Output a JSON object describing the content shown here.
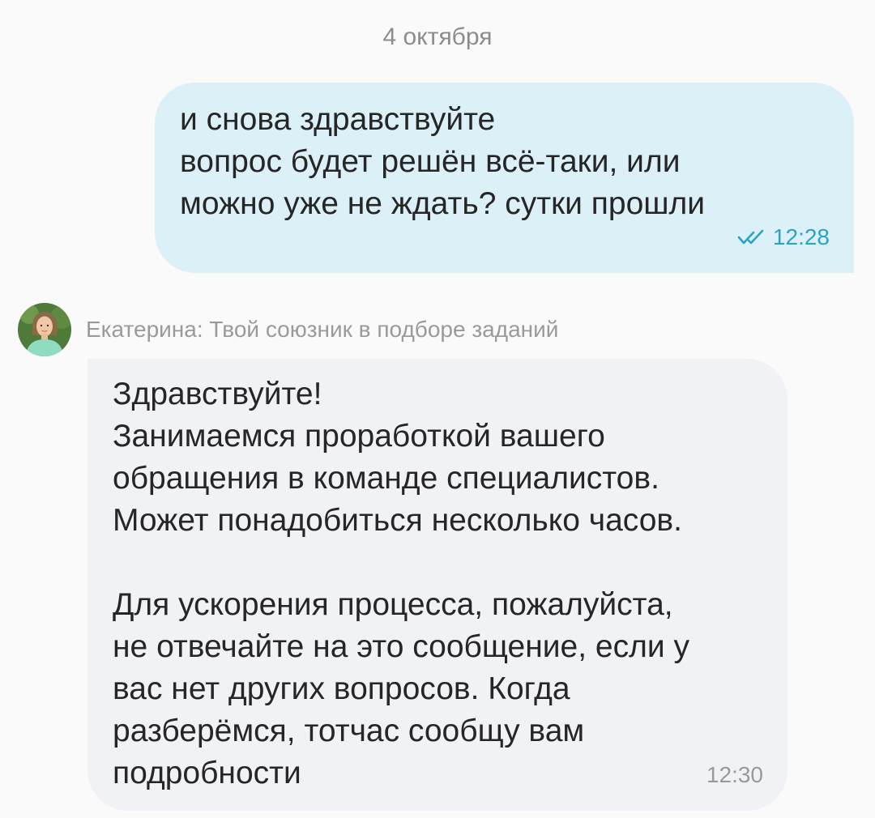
{
  "chat": {
    "date_separator": "4 октября",
    "outgoing": {
      "text": "и снова здравствуйте\nвопрос будет решён всё-таки, или\nможно уже не ждать? сутки прошли",
      "time": "12:28",
      "status_icon": "double-check-icon",
      "status_color": "#2aa3c4"
    },
    "incoming": {
      "sender_name": "Екатерина: Твой союзник в подборе заданий",
      "avatar_icon": "avatar-icon",
      "text": "Здравствуйте!\nЗанимаемся проработкой вашего\nобращения в команде специалистов.\nМожет понадобиться несколько часов.\n\nДля ускорения процесса, пожалуйста,\nне отвечайте на это сообщение, если у\nвас нет других вопросов. Когда\nразберёмся, тотчас сообщу вам\nподробности",
      "time": "12:30"
    }
  }
}
